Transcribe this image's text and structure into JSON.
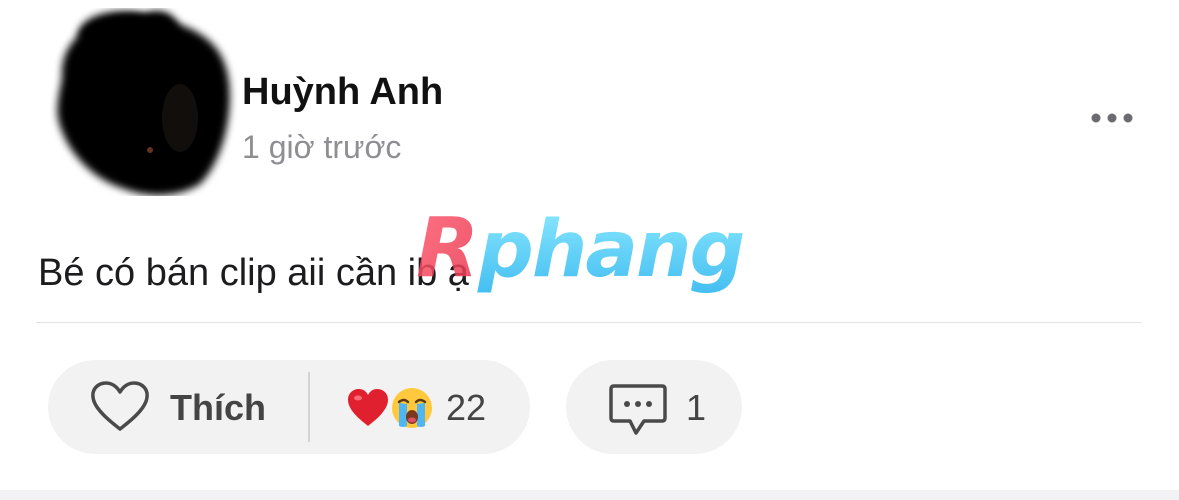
{
  "post": {
    "author_name": "Huỳnh Anh",
    "timestamp": "1 giờ trước",
    "text": "Bé có bán clip aii cần ib ạ",
    "more_icon": "ellipsis-icon"
  },
  "watermark": {
    "text": "Rphang"
  },
  "actions": {
    "like_label": "Thích",
    "like_icon": "heart-outline-icon",
    "reaction_icons": [
      "red-heart-emoji",
      "loudly-crying-emoji"
    ],
    "reaction_count": "22",
    "comment_icon": "comment-bubble-icon",
    "comment_count": "1"
  },
  "colors": {
    "secondary_text": "#8e8e93",
    "pill_background": "#f2f2f3",
    "heart_red": "#e0202e"
  }
}
